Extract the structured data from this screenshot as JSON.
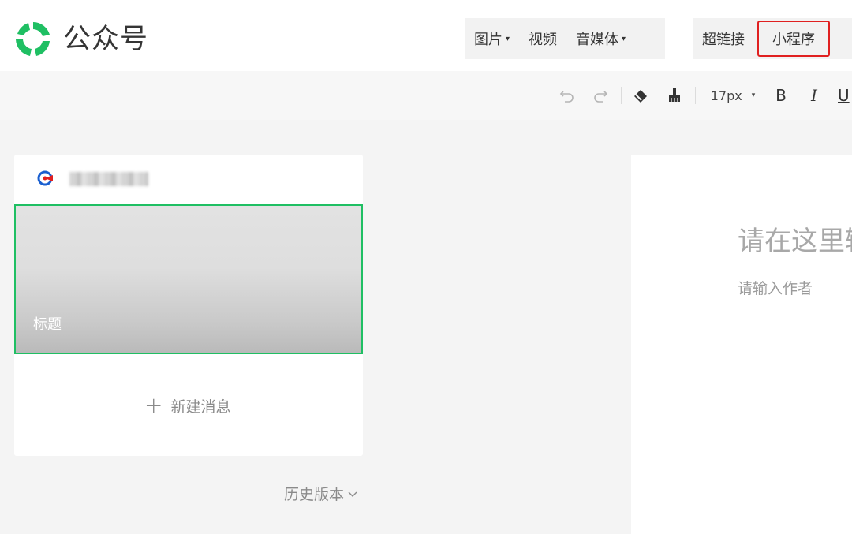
{
  "app": {
    "brand": "公众号",
    "logo_icon": "wechat-official-account-logo-icon"
  },
  "insert_menu": {
    "image": "图片",
    "video": "视频",
    "audio": "音媒体",
    "hyperlink": "超链接",
    "mini_program": "小程序"
  },
  "toolbar": {
    "undo_icon": "undo-icon",
    "redo_icon": "redo-icon",
    "eraser_icon": "eraser-icon",
    "format_painter_icon": "format-painter-icon",
    "font_size": "17px",
    "bold": "B",
    "italic": "I",
    "underline": "U"
  },
  "article_list": {
    "account_icon": "account-avatar-icon",
    "cover_title": "标题",
    "new_message": "新建消息",
    "history_version": "历史版本"
  },
  "editor": {
    "title_placeholder": "请在这里输入标题",
    "author_placeholder": "请输入作者"
  },
  "colors": {
    "brand_green": "#1fbf63",
    "highlight_red": "#e02020",
    "background": "#f4f4f4"
  }
}
